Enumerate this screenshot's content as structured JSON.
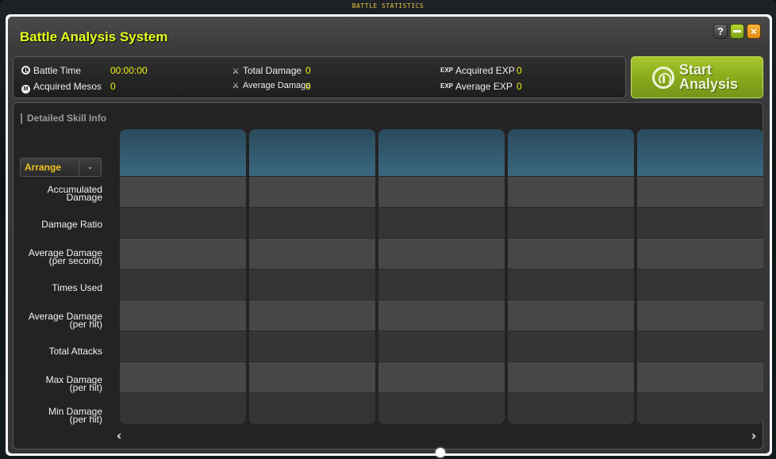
{
  "frame": {
    "title": "BATTLE STATISTICS"
  },
  "window": {
    "title": "Battle Analysis System",
    "help_label": "?",
    "close_label": "×"
  },
  "stats": {
    "battle_time": {
      "icon": "clock-icon",
      "label": "Battle Time",
      "value": "00:00:00"
    },
    "acquired_mesos": {
      "icon": "meso-icon",
      "icon_text": "M",
      "label": "Acquired Mesos",
      "value": "0"
    },
    "total_damage": {
      "icon": "sword-icon",
      "icon_text": "⚔",
      "label": "Total Damage",
      "value": "0"
    },
    "average_damage": {
      "icon": "sword-icon",
      "icon_text": "⚔",
      "label": "Average Damage",
      "value": "0"
    },
    "acquired_exp": {
      "icon": "exp-icon",
      "icon_text": "EXP",
      "label": "Acquired EXP",
      "value": "0"
    },
    "average_exp": {
      "icon": "exp-icon",
      "icon_text": "EXP",
      "label": "Average EXP",
      "value": "0"
    }
  },
  "start_button": {
    "line1": "Start",
    "line2": "Analysis"
  },
  "detail": {
    "title": "Detailed Skill Info",
    "arrange": {
      "label": "Arrange",
      "chevron": "⌄"
    },
    "rows": [
      {
        "main": "Accumulated",
        "sub": "Damage"
      },
      {
        "main": "Damage Ratio",
        "sub": ""
      },
      {
        "main": "Average Damage",
        "sub": "(per second)"
      },
      {
        "main": "Times Used",
        "sub": ""
      },
      {
        "main": "Average Damage",
        "sub": "(per hit)"
      },
      {
        "main": "Total Attacks",
        "sub": ""
      },
      {
        "main": "Max Damage",
        "sub": "(per hit)"
      },
      {
        "main": "Min Damage",
        "sub": "(per hit)"
      }
    ],
    "column_count": 5,
    "nav": {
      "prev": "‹",
      "next": "›"
    },
    "pagination": {
      "current_page": 1,
      "total_pages": 1
    }
  }
}
